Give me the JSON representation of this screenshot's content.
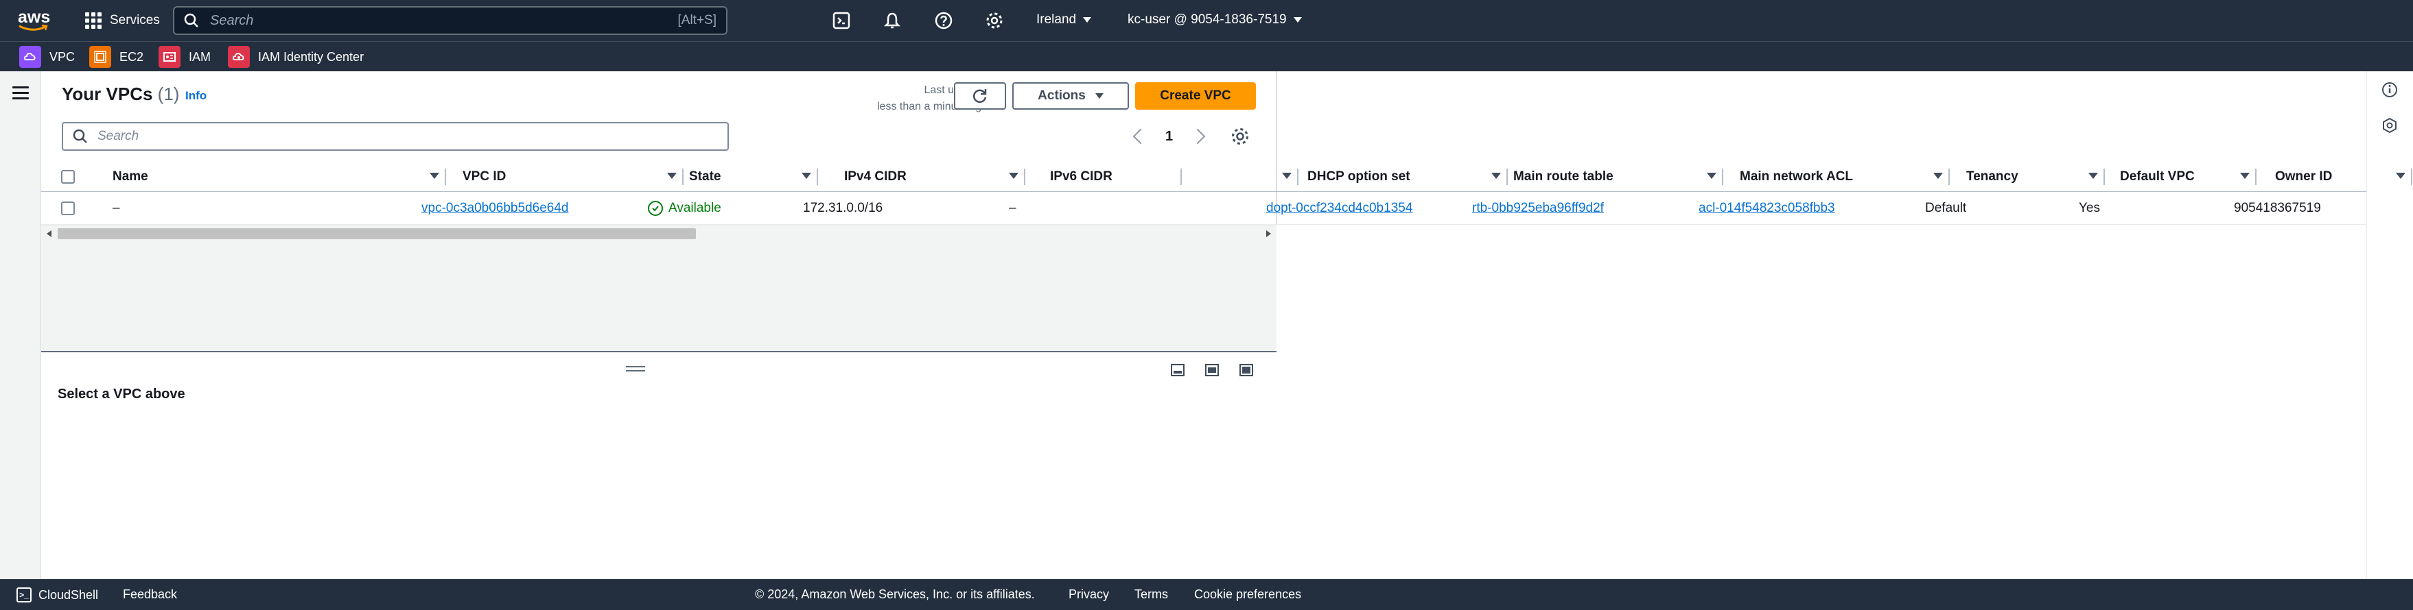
{
  "topnav": {
    "logo_text": "aws",
    "services_label": "Services",
    "search_placeholder": "Search",
    "search_shortcut": "[Alt+S]",
    "region": "Ireland",
    "account": "kc-user @ 9054-1836-7519"
  },
  "favorites": [
    {
      "label": "VPC",
      "color": "#8c4fff"
    },
    {
      "label": "EC2",
      "color": "#ed7100"
    },
    {
      "label": "IAM",
      "color": "#dd344c"
    },
    {
      "label": "IAM Identity Center",
      "color": "#dd344c"
    }
  ],
  "header": {
    "title": "Your VPCs",
    "count": "(1)",
    "info": "Info",
    "last_updated_label": "Last updated",
    "last_updated_value": "less than a minute ago",
    "actions_label": "Actions",
    "create_label": "Create VPC",
    "search_placeholder": "Search",
    "page_number": "1"
  },
  "table": {
    "columns": [
      "Name",
      "VPC ID",
      "State",
      "IPv4 CIDR",
      "IPv6 CIDR",
      "",
      "DHCP option set",
      "Main route table",
      "Main network ACL",
      "Tenancy",
      "Default VPC",
      "Owner ID"
    ],
    "rows": [
      {
        "name": "–",
        "vpc_id": "vpc-0c3a0b06bb5d6e64d",
        "state": "Available",
        "ipv4": "172.31.0.0/16",
        "ipv6": "–",
        "dhcp": "dopt-0ccf234cd4c0b1354",
        "route_table": "rtb-0bb925eba96ff9d2f",
        "acl": "acl-014f54823c058fbb3",
        "tenancy": "Default",
        "default_vpc": "Yes",
        "owner": "905418367519"
      }
    ]
  },
  "split_panel": {
    "message": "Select a VPC above"
  },
  "footer": {
    "cloudshell": "CloudShell",
    "feedback": "Feedback",
    "copyright": "© 2024, Amazon Web Services, Inc. or its affiliates.",
    "privacy": "Privacy",
    "terms": "Terms",
    "cookies": "Cookie preferences"
  },
  "colors": {
    "nav_bg": "#232f3e",
    "primary_button": "#ff9900",
    "link": "#0972d3",
    "status_available": "#037f0c"
  }
}
